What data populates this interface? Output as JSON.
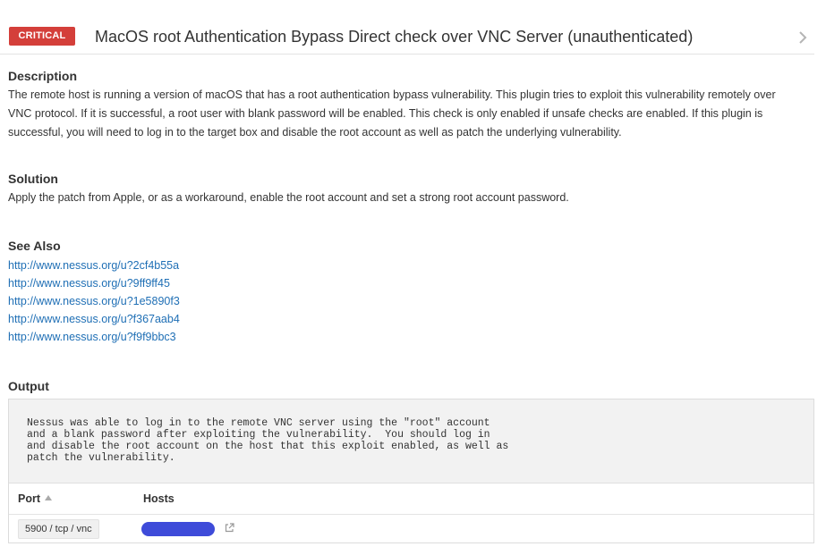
{
  "header": {
    "severity": "CRITICAL",
    "severity_color": "#d43f3a",
    "title": "MacOS root Authentication Bypass Direct check over VNC Server (unauthenticated)",
    "next_icon": "chevron-right-icon"
  },
  "description": {
    "heading": "Description",
    "line1": "The remote host is running a version of macOS that has a root authentication bypass vulnerability. This plugin tries to exploit this vulnerability remotely over",
    "line2": "VNC protocol. If it is successful, a root user with blank password will be enabled. This check is only enabled if unsafe checks are enabled. If this plugin is",
    "line3": "successful, you will need to log in to the target box and disable the root account as well as patch the underlying vulnerability."
  },
  "solution": {
    "heading": "Solution",
    "text": "Apply the patch from Apple, or as a workaround, enable the root account and set a strong root account password."
  },
  "see_also": {
    "heading": "See Also",
    "links": [
      "http://www.nessus.org/u?2cf4b55a",
      "http://www.nessus.org/u?9ff9ff45",
      "http://www.nessus.org/u?1e5890f3",
      "http://www.nessus.org/u?f367aab4",
      "http://www.nessus.org/u?f9f9bbc3"
    ],
    "link_color": "#1f6fb5"
  },
  "output": {
    "heading": "Output",
    "text": "Nessus was able to log in to the remote VNC server using the \"root\" account\nand a blank password after exploiting the vulnerability.  You should log in\nand disable the root account on the host that this exploit enabled, as well as\npatch the vulnerability.",
    "columns": {
      "port": "Port",
      "hosts": "Hosts"
    },
    "sort_icon": "sort-ascending-icon",
    "rows": [
      {
        "port": "5900 / tcp / vnc",
        "host_redacted_color": "#3e4bd9",
        "link_icon": "external-link-icon"
      }
    ]
  }
}
